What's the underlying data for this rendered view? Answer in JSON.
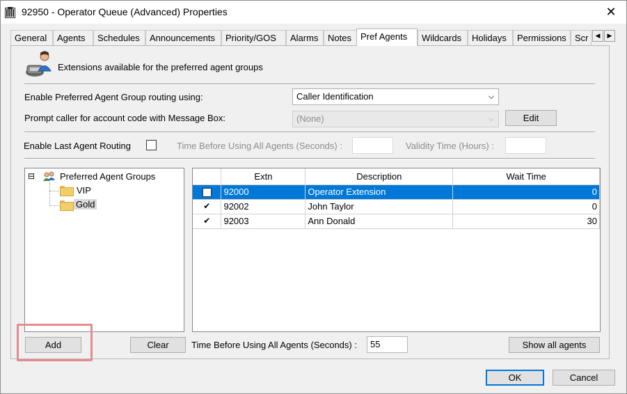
{
  "window": {
    "title": "92950 - Operator Queue (Advanced) Properties",
    "close_glyph": "✕"
  },
  "tabs": [
    {
      "label": "General"
    },
    {
      "label": "Agents"
    },
    {
      "label": "Schedules"
    },
    {
      "label": "Announcements"
    },
    {
      "label": "Priority/GOS"
    },
    {
      "label": "Alarms"
    },
    {
      "label": "Notes"
    },
    {
      "label": "Pref Agents",
      "active": true
    },
    {
      "label": "Wildcards"
    },
    {
      "label": "Holidays"
    },
    {
      "label": "Permissions"
    },
    {
      "label": "Scr"
    }
  ],
  "header": {
    "description": "Extensions available for the preferred agent groups"
  },
  "routing": {
    "label": "Enable Preferred Agent Group routing using:",
    "value": "Caller Identification"
  },
  "prompt": {
    "label": "Prompt caller for account code with Message Box:",
    "value": "(None)",
    "edit_label": "Edit"
  },
  "last_agent": {
    "label": "Enable Last Agent Routing",
    "checked": false,
    "time_before_label": "Time Before Using All Agents (Seconds) :",
    "time_before_value": "",
    "validity_label": "Validity Time (Hours) :",
    "validity_value": ""
  },
  "tree": {
    "root": "Preferred Agent Groups",
    "expander": "⊟",
    "children": [
      {
        "label": "VIP"
      },
      {
        "label": "Gold",
        "selected": true
      }
    ]
  },
  "grid": {
    "columns": [
      "",
      "Extn",
      "Description",
      "Wait Time"
    ],
    "rows": [
      {
        "checked": false,
        "extn": "92000",
        "description": "Operator Extension",
        "wait": "0",
        "selected": true
      },
      {
        "checked": true,
        "extn": "92002",
        "description": "John Taylor",
        "wait": "0"
      },
      {
        "checked": true,
        "extn": "92003",
        "description": "Ann Donald",
        "wait": "30"
      }
    ]
  },
  "bottom": {
    "add_label": "Add",
    "clear_label": "Clear",
    "time_label": "Time Before Using All Agents (Seconds) :",
    "time_value": "55",
    "show_all_label": "Show all agents"
  },
  "footer": {
    "ok_label": "OK",
    "cancel_label": "Cancel"
  },
  "colors": {
    "selection": "#0078d7",
    "highlight_box": "#e58a8e"
  }
}
